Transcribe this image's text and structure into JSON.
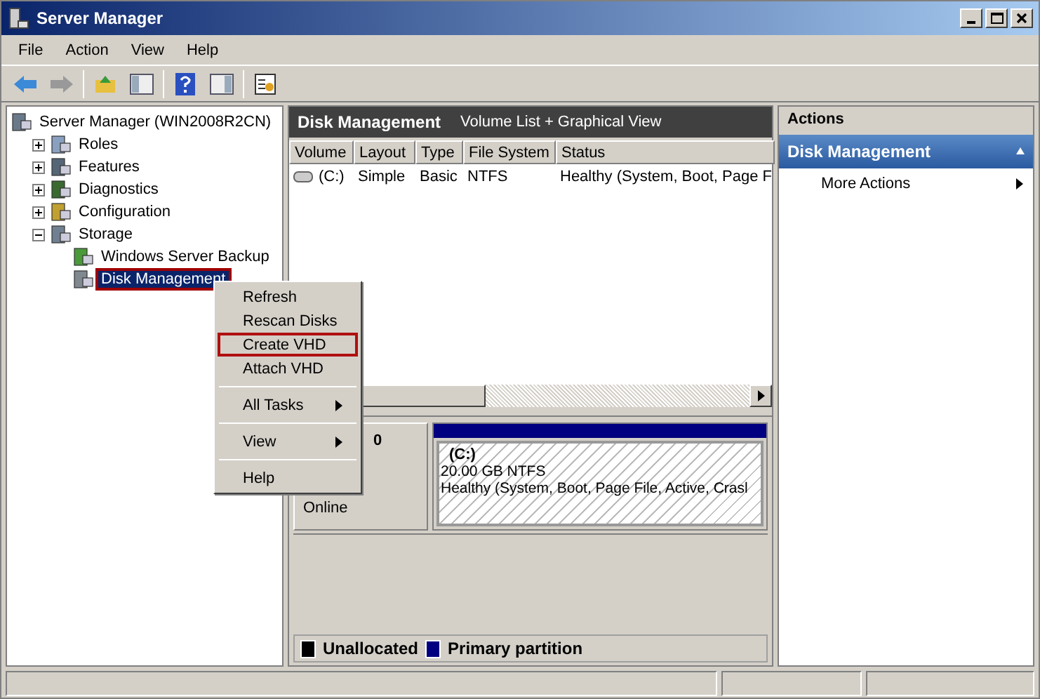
{
  "window": {
    "title": "Server Manager"
  },
  "menu_bar": [
    "File",
    "Action",
    "View",
    "Help"
  ],
  "tree": {
    "label": "Server Manager (WIN2008R2CN)",
    "children": [
      {
        "label": "Roles",
        "expanded": false,
        "selected": false
      },
      {
        "label": "Features",
        "expanded": false,
        "selected": false
      },
      {
        "label": "Diagnostics",
        "expanded": false,
        "selected": false
      },
      {
        "label": "Configuration",
        "expanded": false,
        "selected": false
      },
      {
        "label": "Storage",
        "expanded": true,
        "selected": false,
        "children": [
          {
            "label": "Windows Server Backup",
            "selected": false
          },
          {
            "label": "Disk Management",
            "selected": true
          }
        ]
      }
    ]
  },
  "center": {
    "title": "Disk Management",
    "subtitle": "Volume List + Graphical View",
    "columns": [
      "Volume",
      "Layout",
      "Type",
      "File System",
      "Status"
    ],
    "rows": [
      [
        "(C:)",
        "Simple",
        "Basic",
        "NTFS",
        "Healthy (System, Boot, Page F"
      ]
    ],
    "disk": {
      "number": "0",
      "status": "Online",
      "partition": {
        "name": "(C:)",
        "size": "20.00 GB NTFS",
        "status": "Healthy (System, Boot, Page File, Active, Crasl"
      }
    },
    "legend": [
      {
        "label": "Unallocated",
        "color": "#000000"
      },
      {
        "label": "Primary partition",
        "color": "#000080"
      }
    ]
  },
  "actions": {
    "title": "Actions",
    "section": "Disk Management",
    "items": [
      "More Actions"
    ]
  },
  "context_menu": [
    {
      "kind": "item",
      "label": "Refresh",
      "highlighted": false,
      "submenu": false
    },
    {
      "kind": "item",
      "label": "Rescan Disks",
      "highlighted": false,
      "submenu": false
    },
    {
      "kind": "item",
      "label": "Create VHD",
      "highlighted": true,
      "submenu": false
    },
    {
      "kind": "item",
      "label": "Attach VHD",
      "highlighted": false,
      "submenu": false
    },
    {
      "kind": "separator"
    },
    {
      "kind": "item",
      "label": "All Tasks",
      "highlighted": false,
      "submenu": true
    },
    {
      "kind": "separator"
    },
    {
      "kind": "item",
      "label": "View",
      "highlighted": false,
      "submenu": true
    },
    {
      "kind": "separator"
    },
    {
      "kind": "item",
      "label": "Help",
      "highlighted": false,
      "submenu": false
    }
  ]
}
